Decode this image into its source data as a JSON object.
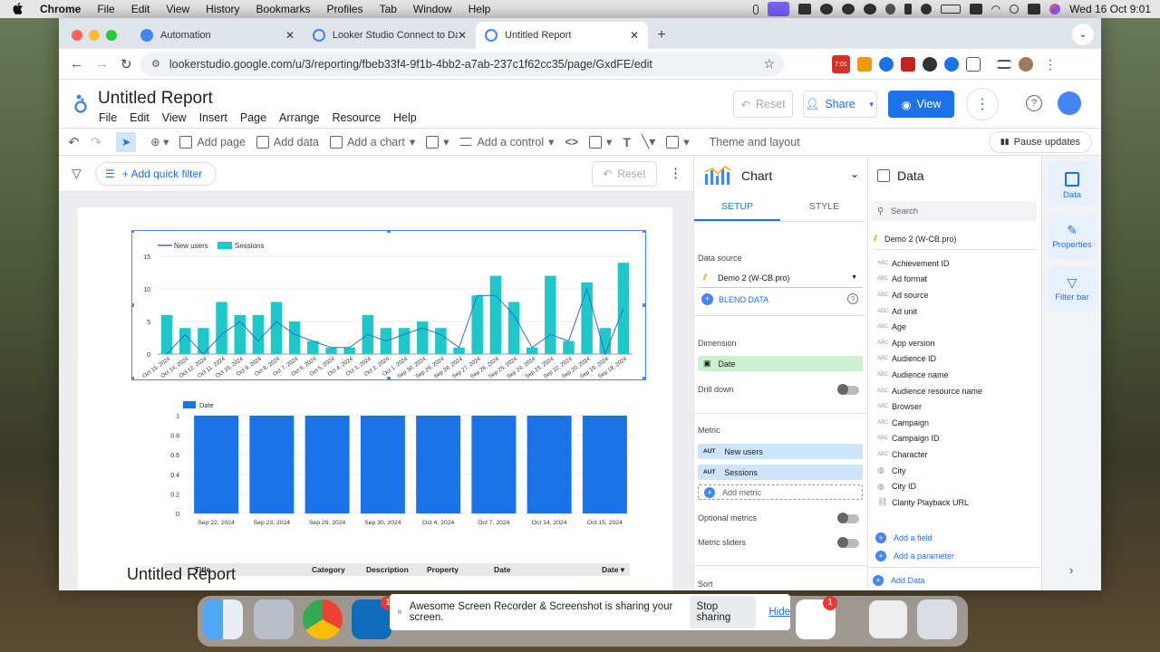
{
  "mac_menu": {
    "apple": "",
    "app": "Chrome",
    "items": [
      "File",
      "Edit",
      "View",
      "History",
      "Bookmarks",
      "Profiles",
      "Tab",
      "Window",
      "Help"
    ],
    "clock": "Wed 16 Oct  9:01"
  },
  "tabs": [
    {
      "label": "Automation"
    },
    {
      "label": "Looker Studio Connect to Dat"
    },
    {
      "label": "Untitled Report"
    }
  ],
  "url": "lookerstudio.google.com/u/3/reporting/fbeb33f4-9f1b-4bb2-a7ab-237c1f62cc35/page/GxdFE/edit",
  "ext_badge": "7:01",
  "app": {
    "title": "Untitled Report",
    "menu": [
      "File",
      "Edit",
      "View",
      "Insert",
      "Page",
      "Arrange",
      "Resource",
      "Help"
    ],
    "reset": "Reset",
    "share": "Share",
    "view": "View"
  },
  "toolbar": {
    "add_page": "Add page",
    "add_data": "Add data",
    "add_chart": "Add a chart",
    "add_control": "Add a control",
    "theme": "Theme and layout",
    "pause": "Pause updates"
  },
  "filterbar": {
    "quick_filter": "+ Add quick filter",
    "reset": "Reset"
  },
  "chart_panel": {
    "title": "Chart",
    "tab_setup": "SETUP",
    "tab_style": "STYLE",
    "data_source_label": "Data source",
    "data_source": "Demo 2 (W-CB.pro)",
    "blend": "BLEND DATA",
    "dimension_label": "Dimension",
    "dimension": "Date",
    "drill_down": "Drill down",
    "metric_label": "Metric",
    "metric_tag": "AUT",
    "metrics": [
      "New users",
      "Sessions"
    ],
    "add_metric": "Add metric",
    "optional_metrics": "Optional metrics",
    "metric_sliders": "Metric sliders",
    "sort": "Sort"
  },
  "data_panel": {
    "title": "Data",
    "search_placeholder": "Search",
    "source": "Demo 2 (W-CB.pro)",
    "type_tag": "ABC",
    "fields": [
      "Achievement ID",
      "Ad format",
      "Ad source",
      "Ad unit",
      "Age",
      "App version",
      "Audience ID",
      "Audience name",
      "Audience resource name",
      "Browser",
      "Campaign",
      "Campaign ID",
      "Character",
      "City",
      "City ID",
      "Clarity Playback URL"
    ],
    "add_field": "Add a field",
    "add_parameter": "Add a parameter",
    "add_data": "Add Data"
  },
  "rail": {
    "data": "Data",
    "properties": "Properties",
    "filter_bar": "Filter bar"
  },
  "table_headers": [
    "Title",
    "Category",
    "Description",
    "Property",
    "Date",
    "Date ▾"
  ],
  "background_text": "Untitled Report",
  "sharing": {
    "text": "Awesome Screen Recorder & Screenshot is sharing your screen.",
    "stop": "Stop sharing",
    "hide": "Hide"
  },
  "dock_badges": [
    "1",
    "1"
  ],
  "colors": {
    "teal": "#1fc8c8",
    "blue": "#1a73e8",
    "line": "#2f6bd9"
  },
  "chart_data": [
    {
      "type": "bar",
      "title": "",
      "legend": [
        "New users",
        "Sessions"
      ],
      "categories": [
        "Oct 15, 2024",
        "Oct 14, 2024",
        "Oct 12, 2024",
        "Oct 11, 2024",
        "Oct 10, 2024",
        "Oct 9, 2024",
        "Oct 8, 2024",
        "Oct 7, 2024",
        "Oct 6, 2024",
        "Oct 5, 2024",
        "Oct 4, 2024",
        "Oct 3, 2024",
        "Oct 2, 2024",
        "Oct 1, 2024",
        "Sep 30, 2024",
        "Sep 29, 2024",
        "Sep 28, 2024",
        "Sep 27, 2024",
        "Sep 26, 2024",
        "Sep 25, 2024",
        "Sep 24, 2024",
        "Sep 23, 2024",
        "Sep 22, 2024",
        "Sep 20, 2024",
        "Sep 19, 2024",
        "Sep 18, 2024"
      ],
      "series": [
        {
          "name": "Sessions",
          "values": [
            6,
            4,
            4,
            8,
            6,
            6,
            8,
            5,
            2,
            1,
            1,
            6,
            4,
            4,
            5,
            4,
            1,
            9,
            12,
            8,
            1,
            12,
            2,
            11,
            4,
            14
          ]
        },
        {
          "name": "New users",
          "values": [
            0,
            3,
            0,
            3,
            5,
            2,
            5,
            3,
            2,
            1,
            1,
            3,
            2,
            3,
            4,
            3,
            1,
            9,
            9,
            6,
            1,
            3,
            2,
            10,
            0,
            7
          ]
        }
      ],
      "y_ticks": [
        0,
        5,
        10,
        15
      ],
      "ylim": [
        0,
        15
      ]
    },
    {
      "type": "bar",
      "title": "",
      "legend": [
        "Date"
      ],
      "categories": [
        "Sep 22, 2024",
        "Sep 23, 2024",
        "Sep 29, 2024",
        "Sep 30, 2024",
        "Oct 4, 2024",
        "Oct 7, 2024",
        "Oct 14, 2024",
        "Oct 15, 2024"
      ],
      "values": [
        1,
        1,
        1,
        1,
        1,
        1,
        1,
        1
      ],
      "y_ticks": [
        "0",
        "0.2",
        "0.4",
        "0.6",
        "0.8",
        "1"
      ],
      "ylim": [
        0,
        1
      ]
    }
  ]
}
